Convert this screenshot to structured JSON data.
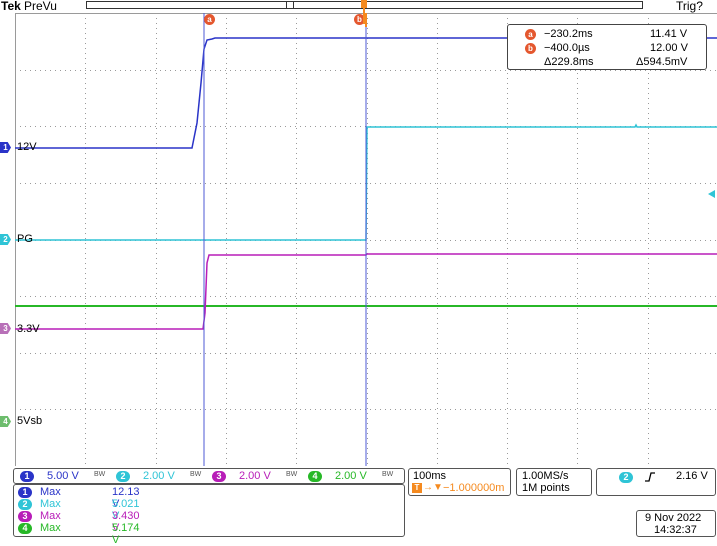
{
  "header": {
    "brand": "Tek",
    "mode": "PreVu",
    "trigger_status": "Trig?"
  },
  "colors": {
    "ch1": "#2a34c8",
    "ch2": "#2fc4d6",
    "ch3": "#b81db8",
    "ch4": "#27b827",
    "cursor": "#4d58d6",
    "trigger": "#f58a1f",
    "grid": "#9a9a9a"
  },
  "channel_labels": {
    "ch1": "12V",
    "ch2": "PG",
    "ch3": "3.3V",
    "ch4": "5Vsb"
  },
  "cursors": {
    "a_label": "a",
    "b_label": "b",
    "a_time": "−230.2ms",
    "a_value": "11.41 V",
    "b_time": "−400.0µs",
    "b_value": "12.00 V",
    "delta_time": "Δ229.8ms",
    "delta_value": "Δ594.5mV"
  },
  "vertical": {
    "ch1": {
      "num": "1",
      "scale": "5.00 V",
      "bw": "BW"
    },
    "ch2": {
      "num": "2",
      "scale": "2.00 V",
      "bw": "BW"
    },
    "ch3": {
      "num": "3",
      "scale": "2.00 V",
      "bw": "BW"
    },
    "ch4": {
      "num": "4",
      "scale": "2.00 V",
      "bw": "BW"
    }
  },
  "horizontal": {
    "timebase": "100ms",
    "delay": "−1.000000m",
    "sample_rate": "1.00MS/s",
    "record_length": "1M points"
  },
  "trigger": {
    "source": "2",
    "slope_icon": "rising-edge-icon",
    "level": "2.16 V"
  },
  "measurements": [
    {
      "ch": "1",
      "name": "Max",
      "value": "12.13 V"
    },
    {
      "ch": "2",
      "name": "Max",
      "value": "5.021 V"
    },
    {
      "ch": "3",
      "name": "Max",
      "value": "3.430 V"
    },
    {
      "ch": "4",
      "name": "Max",
      "value": "5.174 V"
    }
  ],
  "datetime": {
    "date": "9 Nov 2022",
    "time": "14:32:37"
  }
}
